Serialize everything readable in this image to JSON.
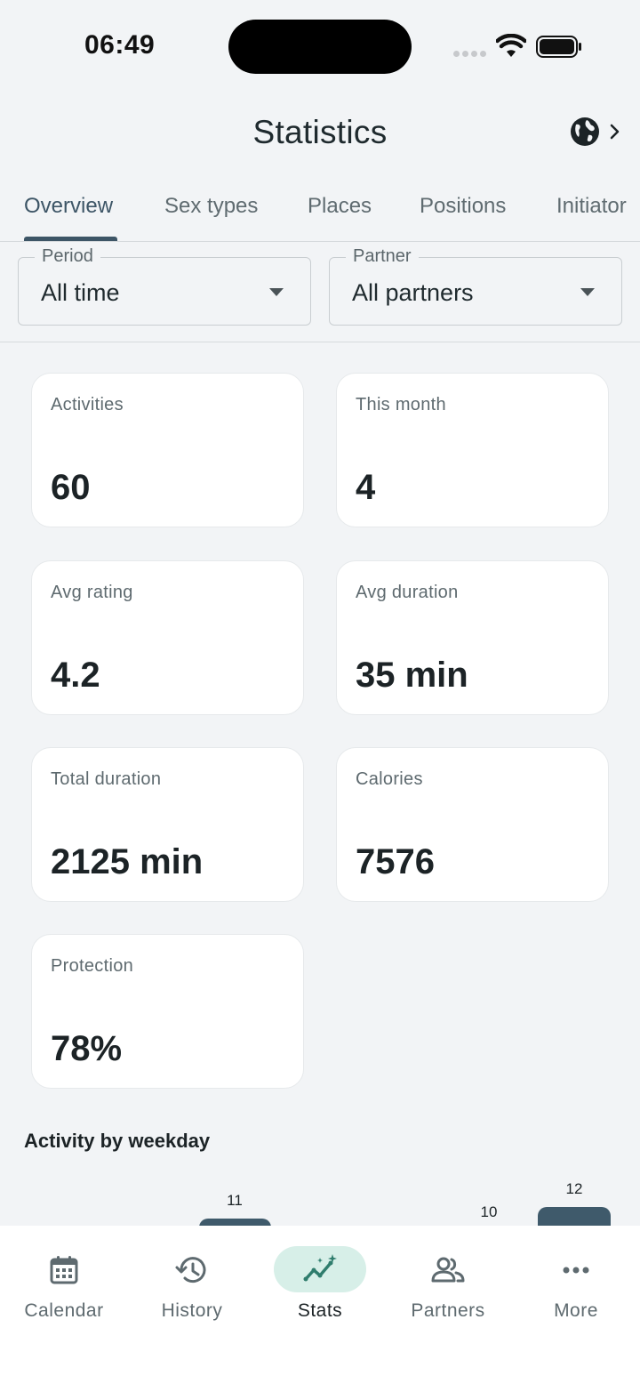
{
  "status": {
    "time": "06:49"
  },
  "header": {
    "title": "Statistics"
  },
  "tabs": [
    {
      "label": "Overview",
      "active": true
    },
    {
      "label": "Sex types",
      "active": false
    },
    {
      "label": "Places",
      "active": false
    },
    {
      "label": "Positions",
      "active": false
    },
    {
      "label": "Initiator",
      "active": false
    }
  ],
  "filters": {
    "period": {
      "label": "Period",
      "value": "All time"
    },
    "partner": {
      "label": "Partner",
      "value": "All partners"
    }
  },
  "cards": [
    {
      "label": "Activities",
      "value": "60"
    },
    {
      "label": "This month",
      "value": "4"
    },
    {
      "label": "Avg rating",
      "value": "4.2"
    },
    {
      "label": "Avg duration",
      "value": "35 min"
    },
    {
      "label": "Total duration",
      "value": "2125 min"
    },
    {
      "label": "Calories",
      "value": "7576"
    },
    {
      "label": "Protection",
      "value": "78%"
    }
  ],
  "weekday_chart": {
    "title": "Activity by weekday",
    "visible_bars": [
      {
        "value": "11"
      },
      {
        "value": "10"
      },
      {
        "value": "12"
      }
    ]
  },
  "nav": [
    {
      "label": "Calendar",
      "icon": "calendar-icon",
      "active": false
    },
    {
      "label": "History",
      "icon": "history-icon",
      "active": false
    },
    {
      "label": "Stats",
      "icon": "stats-icon",
      "active": true
    },
    {
      "label": "Partners",
      "icon": "partners-icon",
      "active": false
    },
    {
      "label": "More",
      "icon": "more-icon",
      "active": false
    }
  ],
  "colors": {
    "accent": "#3d5566",
    "bar": "#3f5a6b",
    "active_pill": "#d7efe8",
    "background": "#f2f4f6",
    "stats_icon": "#2f7d6d"
  }
}
